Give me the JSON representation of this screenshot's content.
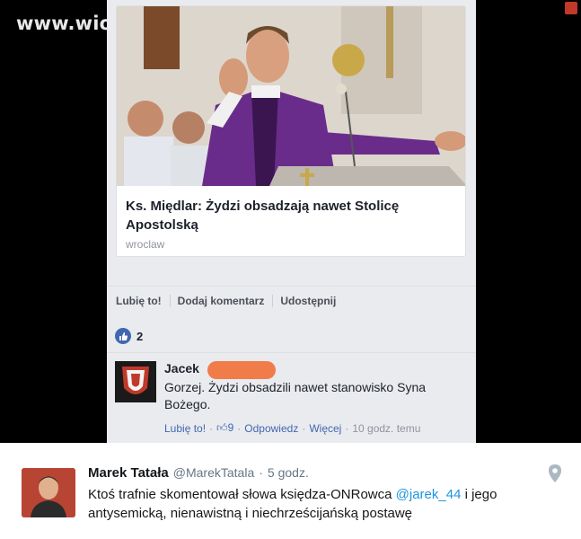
{
  "watermark": "www.wiocha.pl",
  "fb": {
    "card": {
      "title": "Ks. Międlar: Żydzi obsadzają nawet Stolicę Apostolską",
      "source": "wroclaw"
    },
    "actions": {
      "like": "Lubię to!",
      "comment": "Dodaj komentarz",
      "share": "Udostępnij"
    },
    "likes_count": "2",
    "comment": {
      "author": "Jacek",
      "text": "Gorzej. Żydzi obsadzili nawet stanowisko Syna Bożego.",
      "like": "Lubię to!",
      "like_count": "9",
      "reply": "Odpowiedz",
      "more": "Więcej",
      "time": "10 godz. temu"
    }
  },
  "tweet": {
    "name": "Marek Tatała",
    "handle": "@MarekTatala",
    "time": "5 godz.",
    "text_before": "Ktoś trafnie skomentował słowa księdza-ONRowca ",
    "mention": "@jarek_44",
    "text_after": " i jego antysemicką, nienawistną i niechrześcijańską postawę"
  },
  "colors": {
    "fb_blue": "#4267b2",
    "redaction": "#f07c4a",
    "twitter_blue": "#1b95e0"
  },
  "icons": {
    "like_bubble": "thumbs-up-icon",
    "location": "location-pin-icon"
  }
}
